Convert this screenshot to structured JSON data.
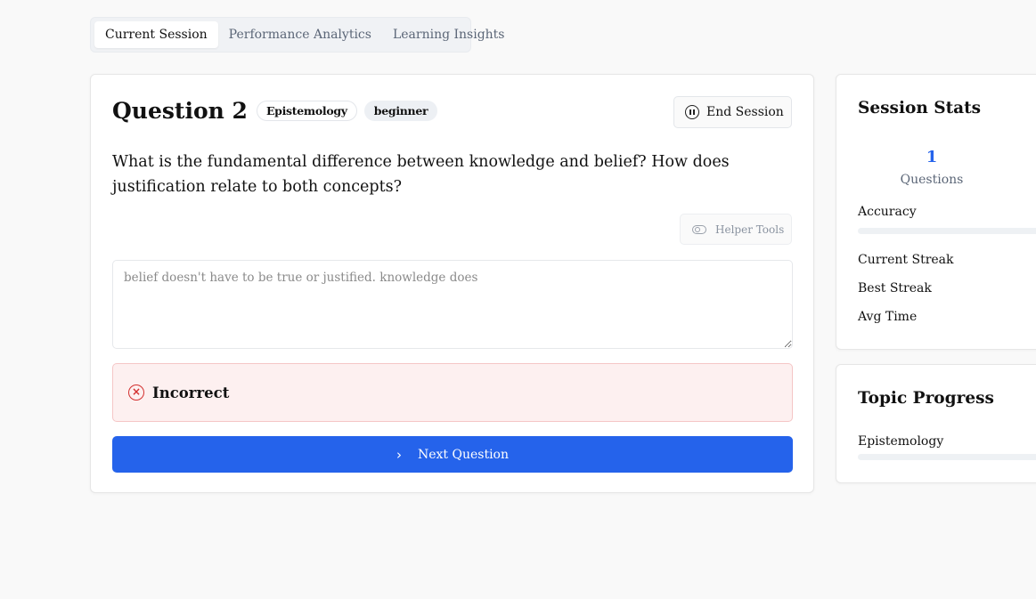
{
  "tabs": [
    {
      "label": "Current Session",
      "active": true
    },
    {
      "label": "Performance Analytics",
      "active": false
    },
    {
      "label": "Learning Insights",
      "active": false
    }
  ],
  "question": {
    "title": "Question 2",
    "topic_badge": "Epistemology",
    "level_badge": "beginner",
    "text": "What is the fundamental difference between knowledge and belief? How does justification relate to both concepts?",
    "end_session_label": "End Session",
    "helper_tools_label": "Helper Tools",
    "answer_value": "belief doesn't have to be true or justified. knowledge does",
    "result_label": "Incorrect",
    "next_label": "Next Question"
  },
  "session_stats": {
    "title": "Session Stats",
    "questions_count": "1",
    "questions_caption": "Questions",
    "accuracy_label": "Accuracy",
    "accuracy_fraction": 0,
    "current_streak_label": "Current Streak",
    "best_streak_label": "Best Streak",
    "avg_time_label": "Avg Time"
  },
  "topic_progress": {
    "title": "Topic Progress",
    "items": [
      {
        "label": "Epistemology",
        "fraction": 0
      }
    ]
  },
  "colors": {
    "accent": "#2563eb",
    "error": "#d3302f",
    "error_bg": "#fdf0f0"
  }
}
